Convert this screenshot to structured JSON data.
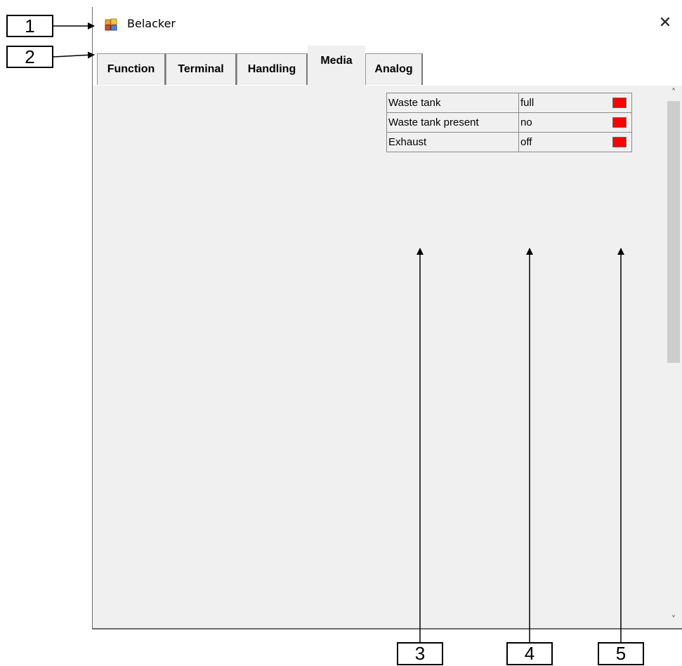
{
  "window": {
    "title": "Belacker",
    "close_glyph": "✕",
    "icon": "app-window-icon"
  },
  "tabs": [
    {
      "label": "Function",
      "active": false
    },
    {
      "label": "Terminal",
      "active": false
    },
    {
      "label": "Handling",
      "active": false
    },
    {
      "label": "Media",
      "active": true
    },
    {
      "label": "Analog",
      "active": false
    }
  ],
  "status_table": {
    "rows": [
      {
        "label": "Waste tank",
        "value": "full",
        "led_color": "#ff0000"
      },
      {
        "label": "Waste tank present",
        "value": "no",
        "led_color": "#ff0000"
      },
      {
        "label": "Exhaust",
        "value": "off",
        "led_color": "#ff0000"
      }
    ]
  },
  "scrollbar": {
    "up_glyph": "˄",
    "down_glyph": "˅"
  },
  "callouts": [
    "1",
    "2",
    "3",
    "4",
    "5"
  ]
}
